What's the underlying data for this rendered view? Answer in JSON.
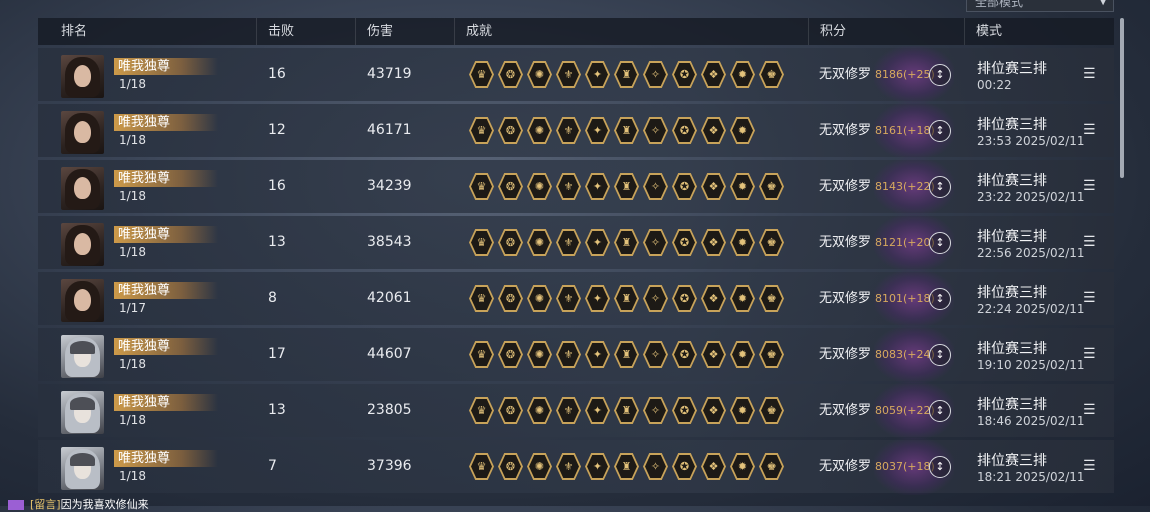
{
  "mode_filter": {
    "label": "全部模式"
  },
  "headers": {
    "rank": "排名",
    "kills": "击败",
    "damage": "伤害",
    "achievements": "成就",
    "score": "积分",
    "mode": "模式"
  },
  "rows": [
    {
      "name": "唯我独尊",
      "sub": "1/18",
      "kills": "16",
      "damage": "43719",
      "badges": 11,
      "title": "无双修罗",
      "score": "8186(+25)",
      "mode": "排位赛三排",
      "time": "00:22",
      "avatar": "a"
    },
    {
      "name": "唯我独尊",
      "sub": "1/18",
      "kills": "12",
      "damage": "46171",
      "badges": 10,
      "title": "无双修罗",
      "score": "8161(+18)",
      "mode": "排位赛三排",
      "time": "23:53  2025/02/11",
      "avatar": "a"
    },
    {
      "name": "唯我独尊",
      "sub": "1/18",
      "kills": "16",
      "damage": "34239",
      "badges": 11,
      "title": "无双修罗",
      "score": "8143(+22)",
      "mode": "排位赛三排",
      "time": "23:22  2025/02/11",
      "avatar": "a"
    },
    {
      "name": "唯我独尊",
      "sub": "1/18",
      "kills": "13",
      "damage": "38543",
      "badges": 11,
      "title": "无双修罗",
      "score": "8121(+20)",
      "mode": "排位赛三排",
      "time": "22:56  2025/02/11",
      "avatar": "a"
    },
    {
      "name": "唯我独尊",
      "sub": "1/17",
      "kills": "8",
      "damage": "42061",
      "badges": 11,
      "title": "无双修罗",
      "score": "8101(+18)",
      "mode": "排位赛三排",
      "time": "22:24  2025/02/11",
      "avatar": "a"
    },
    {
      "name": "唯我独尊",
      "sub": "1/18",
      "kills": "17",
      "damage": "44607",
      "badges": 11,
      "title": "无双修罗",
      "score": "8083(+24)",
      "mode": "排位赛三排",
      "time": "19:10  2025/02/11",
      "avatar": "b"
    },
    {
      "name": "唯我独尊",
      "sub": "1/18",
      "kills": "13",
      "damage": "23805",
      "badges": 11,
      "title": "无双修罗",
      "score": "8059(+22)",
      "mode": "排位赛三排",
      "time": "18:46  2025/02/11",
      "avatar": "b"
    },
    {
      "name": "唯我独尊",
      "sub": "1/18",
      "kills": "7",
      "damage": "37396",
      "badges": 11,
      "title": "无双修罗",
      "score": "8037(+18)",
      "mode": "排位赛三排",
      "time": "18:21  2025/02/11",
      "avatar": "b"
    }
  ],
  "chat": {
    "channel": "[留言]",
    "message": "因为我喜欢修仙来"
  },
  "colors": {
    "gold": "#c8a35a",
    "score": "#d6a95e",
    "glow": "#7a3c8c"
  }
}
